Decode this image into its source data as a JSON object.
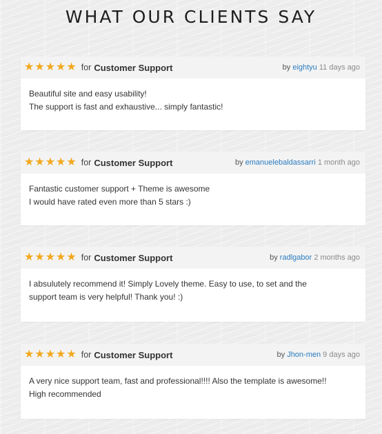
{
  "page_title": "WHAT OUR CLIENTS SAY",
  "accent_color": "#f2a81d",
  "link_color": "#2a7bbf",
  "reviews": [
    {
      "rating": 5,
      "for_word": "for",
      "topic": "Customer Support",
      "by_word": "by",
      "author": "eightyu",
      "age": "11 days ago",
      "lines": [
        "Beautiful site and easy usability!",
        "The support is fast and exhaustive... simply fantastic!"
      ]
    },
    {
      "rating": 5,
      "for_word": "for",
      "topic": "Customer Support",
      "by_word": "by",
      "author": "emanuelebaldassarri",
      "age": "1 month ago",
      "lines": [
        "Fantastic customer support + Theme is awesome",
        "I would have rated even more than 5 stars :)"
      ]
    },
    {
      "rating": 5,
      "for_word": "for",
      "topic": "Customer Support",
      "by_word": "by",
      "author": "radlgabor",
      "age": "2 months ago",
      "lines": [
        "I absulutely recommend it! Simply Lovely theme. Easy to use, to set and the",
        "support team is very helpful! Thank you! :)"
      ]
    },
    {
      "rating": 5,
      "for_word": "for",
      "topic": "Customer Support",
      "by_word": "by",
      "author": "Jhon-men",
      "age": "9 days ago",
      "lines": [
        "A very nice support team, fast and professional!!!! Also the template is awesome!!",
        "High recommended"
      ]
    }
  ]
}
